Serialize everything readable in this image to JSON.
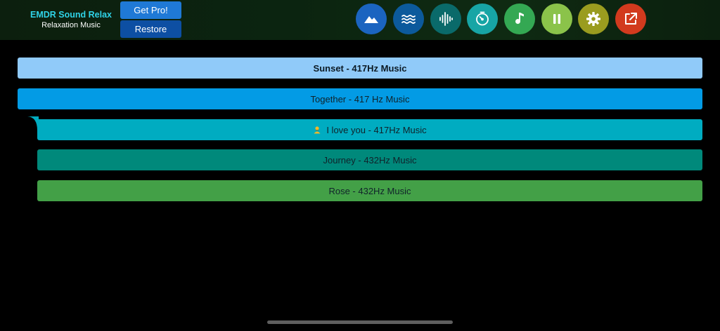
{
  "header": {
    "app_title": "EMDR Sound Relax",
    "app_subtitle": "Relaxation Music",
    "get_pro_label": "Get Pro!",
    "restore_label": "Restore"
  },
  "toolbar": {
    "buttons": [
      {
        "name": "mountain-icon",
        "color": "#1b64c0"
      },
      {
        "name": "waves-icon",
        "color": "#0c5a9c"
      },
      {
        "name": "sound-wave-icon",
        "color": "#0a6a6a"
      },
      {
        "name": "timer-icon",
        "color": "#17a5a5"
      },
      {
        "name": "music-note-icon",
        "color": "#34a853"
      },
      {
        "name": "pause-icon",
        "color": "#8bc34a"
      },
      {
        "name": "gear-icon",
        "color": "#9a9c1f"
      },
      {
        "name": "external-link-icon",
        "color": "#d23a1e"
      }
    ]
  },
  "tracks": [
    {
      "label": "Sunset - 417Hz Music",
      "color": "#90caf9",
      "active": true
    },
    {
      "label": "Together - 417 Hz Music",
      "color": "#039be5"
    },
    {
      "label": "I love you - 417Hz Music",
      "color": "#00acc1",
      "emoji": "🙇"
    },
    {
      "label": "Journey - 432Hz Music",
      "color": "#00897b"
    },
    {
      "label": "Rose - 432Hz Music",
      "color": "#43a047"
    }
  ]
}
